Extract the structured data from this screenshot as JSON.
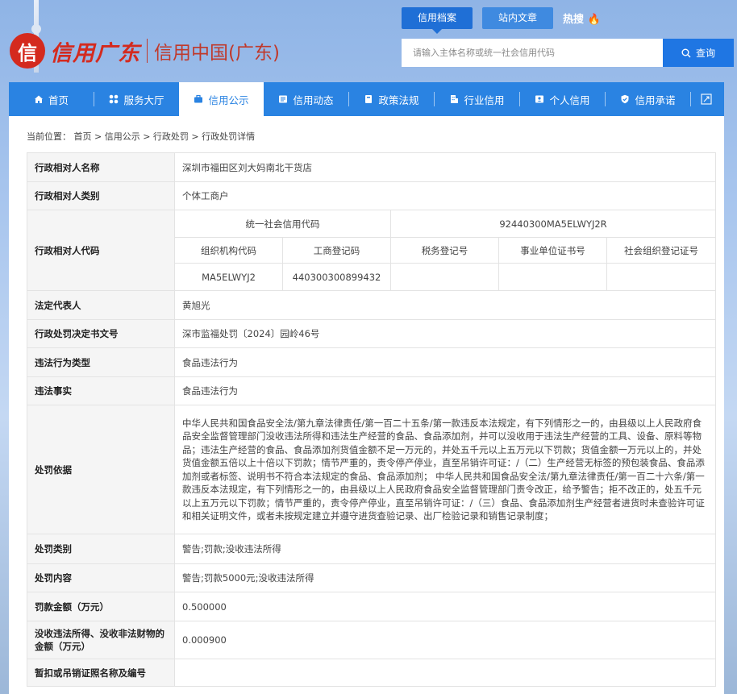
{
  "brand": {
    "mark": "信",
    "brush": "信用广东",
    "name": "信用中国(广东)"
  },
  "top_tabs": [
    {
      "label": "信用档案"
    },
    {
      "label": "站内文章"
    }
  ],
  "hot": "热搜",
  "search": {
    "placeholder": "请输入主体名称或统一社会信用代码",
    "button": "查询"
  },
  "nav": [
    {
      "label": "首页"
    },
    {
      "label": "服务大厅"
    },
    {
      "label": "信用公示"
    },
    {
      "label": "信用动态"
    },
    {
      "label": "政策法规"
    },
    {
      "label": "行业信用"
    },
    {
      "label": "个人信用"
    },
    {
      "label": "信用承诺"
    }
  ],
  "breadcrumb": "当前位置： 首页 > 信用公示 > 行政处罚 > 行政处罚详情",
  "detail": {
    "name_label": "行政相对人名称",
    "name": "深圳市福田区刘大妈南北干货店",
    "type_label": "行政相对人类别",
    "type": "个体工商户",
    "code_label": "行政相对人代码",
    "uscc_label": "统一社会信用代码",
    "uscc": "92440300MA5ELWYJ2R",
    "org_label": "组织机构代码",
    "org": "MA5ELWYJ2",
    "biz_label": "工商登记码",
    "biz": "440300300899432",
    "tax_label": "税务登记号",
    "tax": "",
    "inst_label": "事业单位证书号",
    "inst": "",
    "soc_label": "社会组织登记证号",
    "soc": "",
    "legal_label": "法定代表人",
    "legal": "黄旭光",
    "doc_label": "行政处罚决定书文号",
    "doc": "深市监福处罚〔2024〕园岭46号",
    "vtype_label": "违法行为类型",
    "vtype": "食品违法行为",
    "fact_label": "违法事实",
    "fact": "食品违法行为",
    "basis_label": "处罚依据",
    "basis": "中华人民共和国食品安全法/第九章法律责任/第一百二十五条/第一款违反本法规定，有下列情形之一的，由县级以上人民政府食品安全监督管理部门没收违法所得和违法生产经营的食品、食品添加剂，并可以没收用于违法生产经营的工具、设备、原料等物品；违法生产经营的食品、食品添加剂货值金额不足一万元的，并处五千元以上五万元以下罚款；货值金额一万元以上的，并处货值金额五倍以上十倍以下罚款；情节严重的，责令停产停业，直至吊销许可证：/（二）生产经营无标签的预包装食品、食品添加剂或者标签、说明书不符合本法规定的食品、食品添加剂； 中华人民共和国食品安全法/第九章法律责任/第一百二十六条/第一款违反本法规定，有下列情形之一的，由县级以上人民政府食品安全监督管理部门责令改正，给予警告；拒不改正的，处五千元以上五万元以下罚款；情节严重的，责令停产停业，直至吊销许可证：/（三）食品、食品添加剂生产经营者进货时未查验许可证和相关证明文件，或者未按规定建立并遵守进货查验记录、出厂检验记录和销售记录制度；",
    "category_label": "处罚类别",
    "category": "警告;罚款;没收违法所得",
    "content_label": "处罚内容",
    "content": "警告;罚款5000元;没收违法所得",
    "fine_label": "罚款金额（万元）",
    "fine": "0.500000",
    "confisc_label": "没收违法所得、没收非法财物的金额（万元）",
    "confisc": "0.000900",
    "license_label": "暂扣或吊销证照名称及编号",
    "license": ""
  }
}
